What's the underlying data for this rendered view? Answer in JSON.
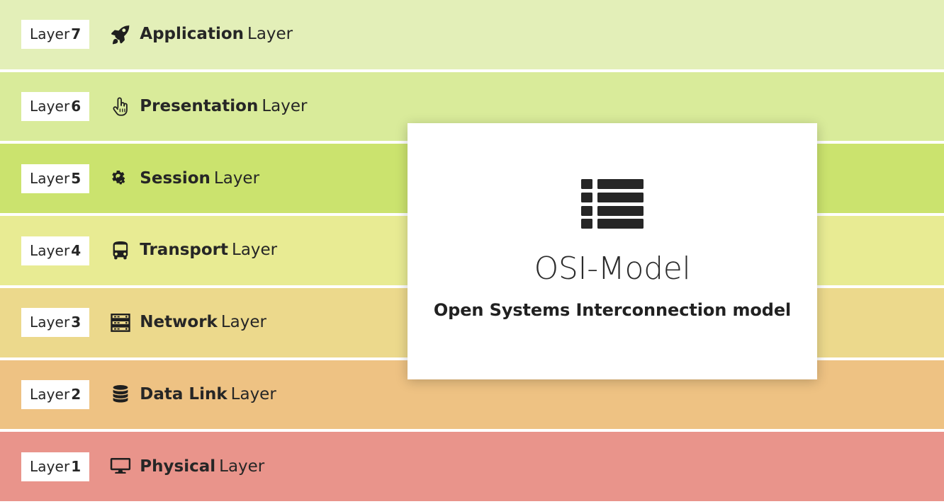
{
  "diagram": {
    "title": "OSI-Model",
    "subtitle": "Open Systems Interconnection model",
    "card_icon": "list-icon",
    "layer_word": "Layer",
    "layers": [
      {
        "badge_word": "Layer",
        "badge_number": "7",
        "name": "Application",
        "suffix": "Layer",
        "icon": "rocket-icon",
        "color": "#e3efb8"
      },
      {
        "badge_word": "Layer",
        "badge_number": "6",
        "name": "Presentation",
        "suffix": "Layer",
        "icon": "hand-pointer-icon",
        "color": "#d9eb9a"
      },
      {
        "badge_word": "Layer",
        "badge_number": "5",
        "name": "Session",
        "suffix": "Layer",
        "icon": "cogs-icon",
        "color": "#cbe36e"
      },
      {
        "badge_word": "Layer",
        "badge_number": "4",
        "name": "Transport",
        "suffix": "Layer",
        "icon": "bus-icon",
        "color": "#e8eb93"
      },
      {
        "badge_word": "Layer",
        "badge_number": "3",
        "name": "Network",
        "suffix": "Layer",
        "icon": "server-icon",
        "color": "#ecd98c"
      },
      {
        "badge_word": "Layer",
        "badge_number": "2",
        "name": "Data Link",
        "suffix": "Layer",
        "icon": "database-icon",
        "color": "#eec283"
      },
      {
        "badge_word": "Layer",
        "badge_number": "1",
        "name": "Physical",
        "suffix": "Layer",
        "icon": "desktop-icon",
        "color": "#e9948b"
      }
    ]
  }
}
